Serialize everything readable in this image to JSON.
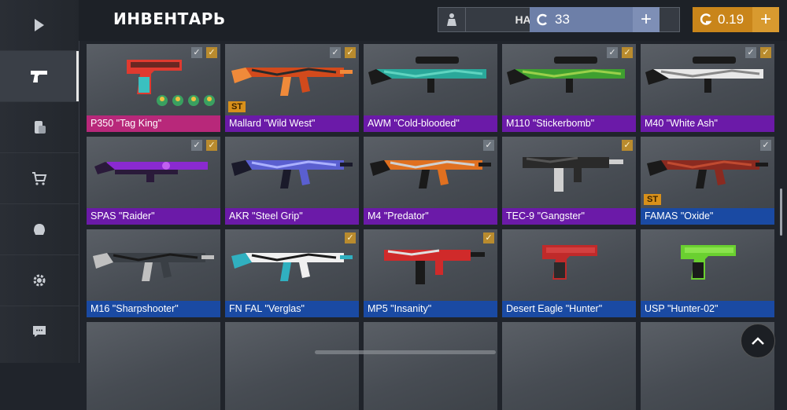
{
  "header": {
    "title": "ИНВЕНТАРЬ",
    "agent_button": "НАСТРОЙКА АГЕНТА",
    "credits": "33",
    "gold": "0.19",
    "plus": "+"
  },
  "sidebar": {
    "items": [
      {
        "icon": "play-icon"
      },
      {
        "icon": "pistol-icon",
        "active": true
      },
      {
        "icon": "coins-icon"
      },
      {
        "icon": "cart-icon"
      },
      {
        "icon": "agent-helmet-icon"
      },
      {
        "icon": "gear-icon"
      },
      {
        "icon": "chat-icon"
      }
    ]
  },
  "inventory": {
    "items": [
      {
        "name": "P350 \"Tag King\"",
        "rarity": "pink",
        "checks": [
          "grey",
          "gold"
        ],
        "stickers": 4,
        "weapon": "pistol",
        "colors": [
          "#e03a2f",
          "#3ac0c0",
          "#1a1a1a"
        ]
      },
      {
        "name": "Mallard \"Wild West\"",
        "rarity": "purple",
        "checks": [
          "grey",
          "gold"
        ],
        "st": "ST",
        "weapon": "rifle",
        "colors": [
          "#d24a1c",
          "#f08a3a",
          "#2a2a2a"
        ]
      },
      {
        "name": "AWM \"Cold-blooded\"",
        "rarity": "purple",
        "checks": [],
        "weapon": "sniper",
        "colors": [
          "#2aa89a",
          "#1a1a1a",
          "#5fd4c0"
        ]
      },
      {
        "name": "M110 \"Stickerbomb\"",
        "rarity": "purple",
        "checks": [
          "grey",
          "gold"
        ],
        "weapon": "sniper",
        "colors": [
          "#3fa030",
          "#1a1a1a",
          "#9ad04a"
        ]
      },
      {
        "name": "M40 \"White Ash\"",
        "rarity": "purple",
        "checks": [
          "grey",
          "gold"
        ],
        "weapon": "sniper",
        "colors": [
          "#e8e8e8",
          "#1a1a1a",
          "#888888"
        ]
      },
      {
        "name": "SPAS \"Raider\"",
        "rarity": "purple",
        "checks": [
          "grey",
          "gold"
        ],
        "weapon": "shotgun",
        "colors": [
          "#8a2ad0",
          "#2a1a3a",
          "#c060f0"
        ]
      },
      {
        "name": "AKR \"Steel Grip\"",
        "rarity": "purple",
        "checks": [],
        "weapon": "rifle",
        "colors": [
          "#5a5fd0",
          "#1a1a2a",
          "#aab0ff"
        ]
      },
      {
        "name": "M4 \"Predator\"",
        "rarity": "purple",
        "checks": [
          "grey"
        ],
        "weapon": "rifle",
        "colors": [
          "#e07020",
          "#1a1a1a",
          "#d0d0d0"
        ]
      },
      {
        "name": "TEC-9 \"Gangster\"",
        "rarity": "purple",
        "checks": [
          "gold"
        ],
        "weapon": "smg",
        "colors": [
          "#2a2a2a",
          "#d0d0d0",
          "#555555"
        ]
      },
      {
        "name": "FAMAS \"Oxide\"",
        "rarity": "blue",
        "checks": [
          "grey"
        ],
        "st": "ST",
        "weapon": "rifle",
        "colors": [
          "#8a2a20",
          "#1a1a1a",
          "#c04a30"
        ]
      },
      {
        "name": "M16 \"Sharpshooter\"",
        "rarity": "blue",
        "checks": [],
        "weapon": "rifle",
        "colors": [
          "#3a3f45",
          "#c0c0c0",
          "#1a1a1a"
        ]
      },
      {
        "name": "FN FAL \"Verglas\"",
        "rarity": "blue",
        "checks": [
          "gold"
        ],
        "weapon": "rifle",
        "colors": [
          "#f0f0f0",
          "#30b0c0",
          "#1a1a1a"
        ]
      },
      {
        "name": "MP5 \"Insanity\"",
        "rarity": "blue",
        "checks": [
          "gold"
        ],
        "weapon": "smg",
        "colors": [
          "#d02a2a",
          "#1a1a1a",
          "#e0e0e0"
        ]
      },
      {
        "name": "Desert Eagle \"Hunter\"",
        "rarity": "blue",
        "checks": [],
        "weapon": "pistol",
        "colors": [
          "#c02a2a",
          "#2a2a2a",
          "#e05050"
        ]
      },
      {
        "name": "USP \"Hunter-02\"",
        "rarity": "blue",
        "checks": [],
        "weapon": "pistol",
        "colors": [
          "#6ad030",
          "#1a1a1a",
          "#a0f060"
        ]
      }
    ]
  }
}
